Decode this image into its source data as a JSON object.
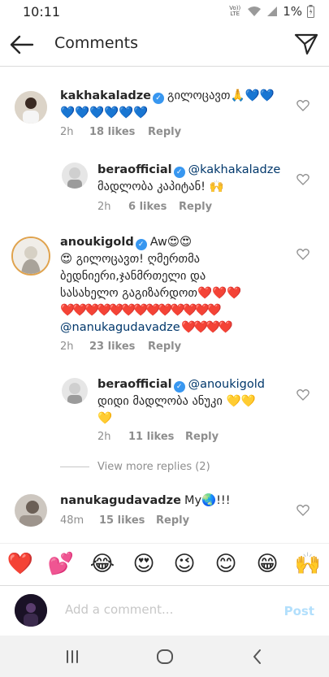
{
  "status": {
    "time": "10:11",
    "volte": "Vo)) LTE",
    "battery": "1%"
  },
  "header": {
    "title": "Comments"
  },
  "comments": [
    {
      "user": "kakhakaladze",
      "text": "გილოცავთ🙏💙💙",
      "text2": "💙💙💙💙💙💙",
      "time": "2h",
      "likes": "18 likes",
      "reply": "Reply"
    },
    {
      "user": "beraofficial",
      "mention": "@kakhakaladze",
      "text": "მადლობა კაპიტან! 🙌",
      "time": "2h",
      "likes": "6 likes",
      "reply": "Reply"
    },
    {
      "user": "anoukigold",
      "text": "Aw😍😍",
      "text2": "😍 გილოცავთ! ღმერთმა",
      "text3": "ბედნიერი,ჯანმრთელი და",
      "text4": "სასახელო გაგიზარდოთ❤️❤️❤️",
      "text5": "❤️❤️❤️❤️❤️❤️❤️❤️❤️❤️❤️❤️❤️",
      "mention": "@nanukagudavadze",
      "text6": " ❤️❤️❤️❤️",
      "time": "2h",
      "likes": "23 likes",
      "reply": "Reply"
    },
    {
      "user": "beraofficial",
      "mention": "@anoukigold",
      "text": "დიდი მადლობა ანუკი 💛💛",
      "text2": "💛",
      "time": "2h",
      "likes": "11 likes",
      "reply": "Reply"
    },
    {
      "user": "nanukagudavadze",
      "text": "My🌏!!!",
      "time": "48m",
      "likes": "15 likes",
      "reply": "Reply"
    }
  ],
  "view_more": "View more replies (2)",
  "emoji_bar": [
    "❤️",
    "💕",
    "😂",
    "😍",
    "😉",
    "😊",
    "😁",
    "🙌"
  ],
  "composer": {
    "placeholder": "Add a comment...",
    "post": "Post"
  },
  "colors": {
    "verified": "#3897f0",
    "mention": "#00376b",
    "post_disabled": "#b2dffc"
  }
}
